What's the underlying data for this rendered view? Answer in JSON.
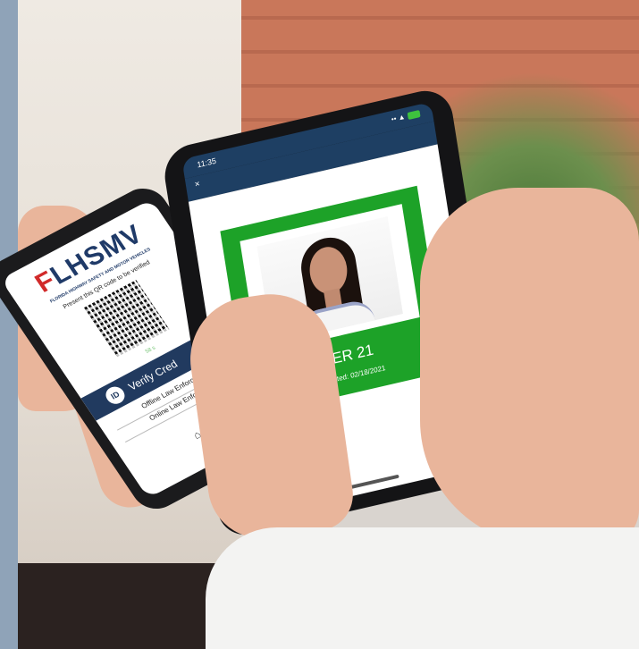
{
  "scene": {
    "left_phone": {
      "logo_letter": "F",
      "logo_text": "LHSMV",
      "agency_line": "FLORIDA HIGHWAY SAFETY AND MOTOR VEHICLES",
      "instruction": "Present this QR code to be verified",
      "timer": "58 s",
      "verify_label": "Verify Cred",
      "id_badge": "ID",
      "options": [
        "Offline Law Enforcement",
        "Online Law Enforcement"
      ],
      "icons": {
        "qr": "qr-code-icon",
        "home": "home-icon"
      }
    },
    "right_phone": {
      "status_time": "11:35",
      "status_icons": "•• ▲",
      "close_icon": "×",
      "status_label": "OVER 21",
      "last_updated": "Last Updated: 02/18/2021",
      "card_color": "#1da228",
      "header_color": "#1e3f63"
    }
  }
}
